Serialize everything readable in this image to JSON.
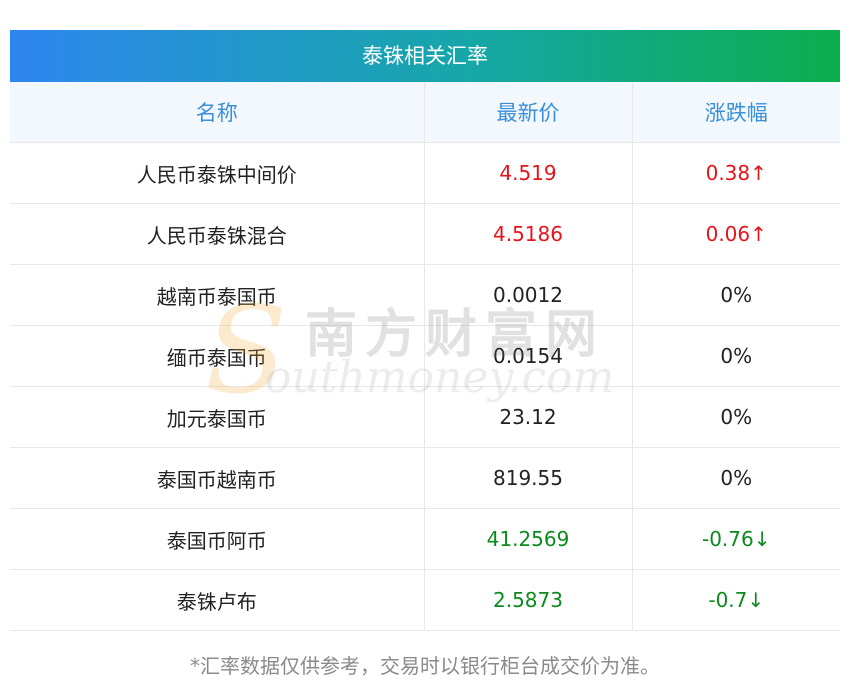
{
  "title": "泰铢相关汇率",
  "columns": [
    "名称",
    "最新价",
    "涨跌幅"
  ],
  "rows": [
    {
      "name": "人民币泰铢中间价",
      "price": "4.519",
      "change": "0.38↑",
      "trend": "up"
    },
    {
      "name": "人民币泰铢混合",
      "price": "4.5186",
      "change": "0.06↑",
      "trend": "up"
    },
    {
      "name": "越南币泰国币",
      "price": "0.0012",
      "change": "0%",
      "trend": "flat"
    },
    {
      "name": "缅币泰国币",
      "price": "0.0154",
      "change": "0%",
      "trend": "flat"
    },
    {
      "name": "加元泰国币",
      "price": "23.12",
      "change": "0%",
      "trend": "flat"
    },
    {
      "name": "泰国币越南币",
      "price": "819.55",
      "change": "0%",
      "trend": "flat"
    },
    {
      "name": "泰国币阿币",
      "price": "41.2569",
      "change": "-0.76↓",
      "trend": "down"
    },
    {
      "name": "泰铢卢布",
      "price": "2.5873",
      "change": "-0.7↓",
      "trend": "down"
    }
  ],
  "footnote": "*汇率数据仅供参考，交易时以银行柜台成交价为准。",
  "watermark": {
    "cn": "南方财富网",
    "en": "outhmoney.com",
    "s": "S"
  },
  "colors": {
    "up": "#e5141b",
    "down": "#0b8a1e",
    "header_text": "#3a8fd9",
    "gradient_start": "#2e86f0",
    "gradient_end": "#0aae4c"
  }
}
